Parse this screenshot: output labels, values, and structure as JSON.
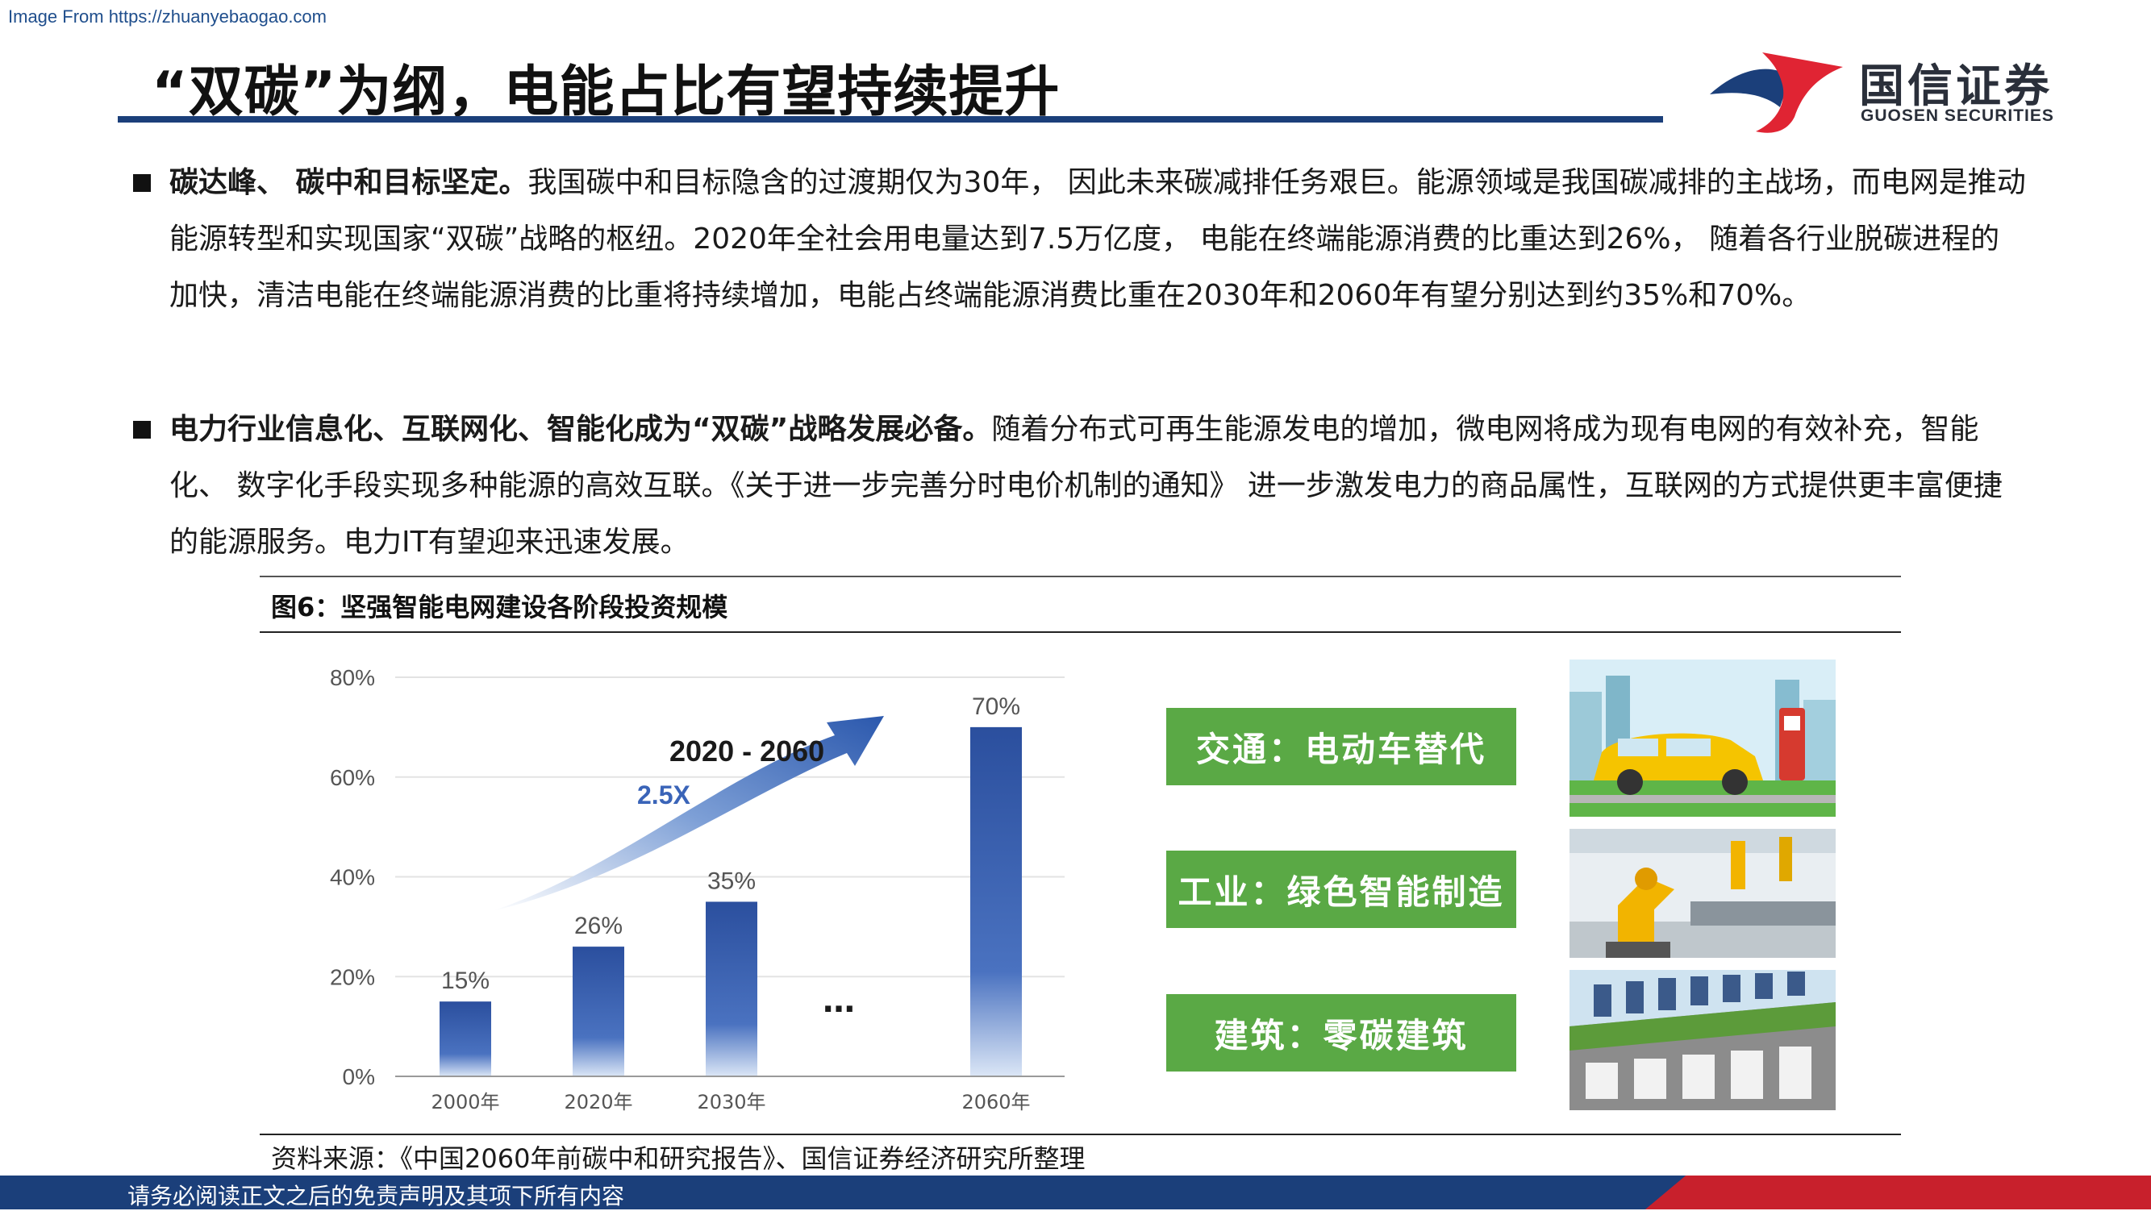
{
  "watermark": "Image From https://zhuanyebaogao.com",
  "title": "“双碳”为纲，电能占比有望持续提升",
  "logo": {
    "cn": "国信证券",
    "en": "GUOSEN SECURITIES",
    "colors": {
      "red": "#e02433",
      "blue": "#1b3f7a"
    }
  },
  "bullets": [
    {
      "bold": "碳达峰、 碳中和目标坚定。",
      "text": "我国碳中和目标隐含的过渡期仅为30年， 因此未来碳减排任务艰巨。能源领域是我国碳减排的主战场，而电网是推动能源转型和实现国家“双碳”战略的枢纽。2020年全社会用电量达到7.5万亿度， 电能在终端能源消费的比重达到26%， 随着各行业脱碳进程的加快，清洁电能在终端能源消费的比重将持续增加，电能占终端能源消费比重在2030年和2060年有望分别达到约35%和70%。"
    },
    {
      "bold": "电力行业信息化、互联网化、智能化成为“双碳”战略发展必备。",
      "text": "随着分布式可再生能源发电的增加，微电网将成为现有电网的有效补充，智能化、 数字化手段实现多种能源的高效互联。《关于进一步完善分时电价机制的通知》 进一步激发电力的商品属性，互联网的方式提供更丰富便捷的能源服务。电力IT有望迎来迅速发展。"
    }
  ],
  "figure": {
    "title": "图6：坚强智能电网建设各阶段投资规模",
    "source": "资料来源：《中国2060年前碳中和研究报告》、国信证券经济研究所整理"
  },
  "chart_data": {
    "type": "bar",
    "categories": [
      "2000年",
      "2020年",
      "2030年",
      "2060年"
    ],
    "values": [
      15,
      26,
      35,
      70
    ],
    "data_labels": [
      "15%",
      "26%",
      "35%",
      "70%"
    ],
    "yticks": [
      "0%",
      "20%",
      "40%",
      "60%",
      "80%"
    ],
    "ylim": [
      0,
      80
    ],
    "annotation": {
      "period": "2020 - 2060",
      "multiplier": "2.5X",
      "ellipsis": "…"
    },
    "bar_color": "#2b4f9e",
    "grid": true
  },
  "panels": [
    {
      "label": "交通：电动车替代",
      "icon": "electric-car-charging-image"
    },
    {
      "label": "工业：绿色智能制造",
      "icon": "industrial-robot-arm-image"
    },
    {
      "label": "建筑：零碳建筑",
      "icon": "green-roof-building-image"
    }
  ],
  "footer": {
    "text": "请务必阅读正文之后的免责声明及其项下所有内容"
  }
}
